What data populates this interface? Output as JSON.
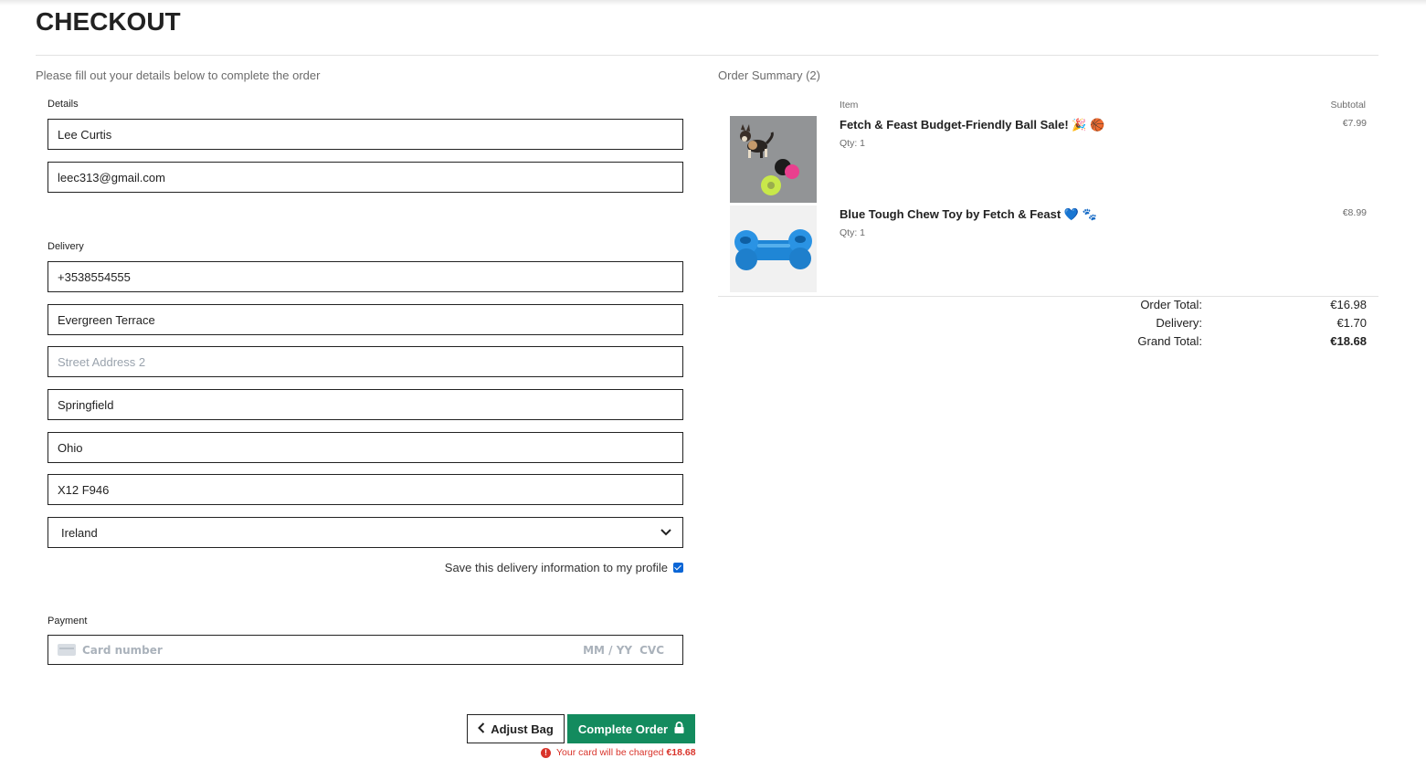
{
  "page": {
    "title": "CHECKOUT",
    "intro": "Please fill out your details below to complete the order"
  },
  "form": {
    "details_label": "Details",
    "full_name": "Lee Curtis",
    "email": "leec313@gmail.com",
    "delivery_label": "Delivery",
    "phone": "+3538554555",
    "street1": "Evergreen Terrace",
    "street2_placeholder": "Street Address 2",
    "town": "Springfield",
    "county": "Ohio",
    "postcode": "X12 F946",
    "country": "Ireland",
    "save_info_label": "Save this delivery information to my profile",
    "save_info_checked": true,
    "payment_label": "Payment",
    "card_placeholder": "Card number",
    "card_expiry_placeholder": "MM / YY",
    "card_cvc_placeholder": "CVC"
  },
  "buttons": {
    "adjust_bag": "Adjust Bag",
    "complete_order": "Complete Order"
  },
  "charge_note": {
    "text": "Your card will be charged",
    "amount": "€18.68"
  },
  "summary": {
    "heading": "Order Summary (2)",
    "col_item": "Item",
    "col_subtotal": "Subtotal",
    "items": [
      {
        "name": "Fetch & Feast Budget-Friendly Ball Sale! 🎉 🏀",
        "qty": "Qty: 1",
        "price": "€7.99",
        "image": "dog-with-balls-photo"
      },
      {
        "name": "Blue Tough Chew Toy by Fetch & Feast 💙 🐾",
        "qty": "Qty: 1",
        "price": "€8.99",
        "image": "blue-bone-toy-photo"
      }
    ],
    "order_total_label": "Order Total:",
    "order_total": "€16.98",
    "delivery_label": "Delivery:",
    "delivery": "€1.70",
    "grand_total_label": "Grand Total:",
    "grand_total": "€18.68"
  },
  "colors": {
    "primary_button": "#138b5e",
    "warning": "#d9342b",
    "checkbox": "#0b66d6"
  }
}
